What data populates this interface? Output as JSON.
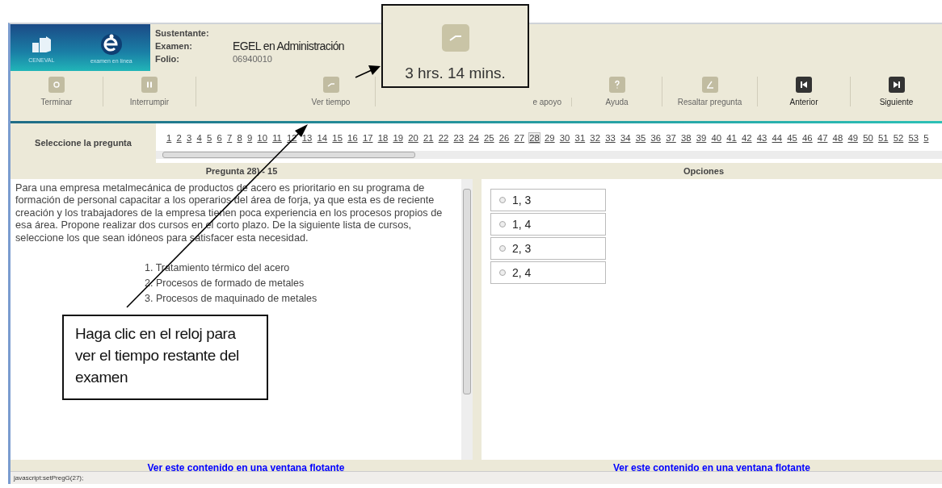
{
  "logo": {
    "left_caption": "CENEVAL",
    "right_caption": "examen en línea"
  },
  "exam_info": [
    {
      "label": "Sustentante:"
    },
    {
      "label": "Examen:",
      "value": "EGEL en Administración"
    },
    {
      "label": "Folio:",
      "value": "06940010"
    }
  ],
  "toolbar": [
    {
      "label": "Terminar",
      "kind": "stop",
      "disabled": true
    },
    {
      "label": "Interrumpir",
      "kind": "pause",
      "disabled": true
    },
    {
      "label": "Ver tiempo",
      "kind": "clock",
      "disabled": true
    },
    {
      "label": "e apoyo",
      "kind": "hidden",
      "disabled": true
    },
    {
      "label": "Ayuda",
      "kind": "help",
      "disabled": true
    },
    {
      "label": "Resaltar pregunta",
      "kind": "highlight",
      "disabled": true
    },
    {
      "label": "Anterior",
      "kind": "prev",
      "disabled": false
    },
    {
      "label": "Siguiente",
      "kind": "next",
      "disabled": false
    }
  ],
  "nav": {
    "label": "Seleccione la pregunta",
    "questions": [
      {
        "number": "1",
        "selected": false
      },
      {
        "number": "2",
        "selected": false
      },
      {
        "number": "3",
        "selected": false
      },
      {
        "number": "4",
        "selected": false
      },
      {
        "number": "5",
        "selected": false
      },
      {
        "number": "6",
        "selected": false
      },
      {
        "number": "7",
        "selected": false
      },
      {
        "number": "8",
        "selected": false
      },
      {
        "number": "9",
        "selected": false
      },
      {
        "number": "10",
        "selected": false
      },
      {
        "number": "11",
        "selected": false
      },
      {
        "number": "12",
        "selected": false
      },
      {
        "number": "13",
        "selected": false
      },
      {
        "number": "14",
        "selected": false
      },
      {
        "number": "15",
        "selected": false
      },
      {
        "number": "16",
        "selected": false
      },
      {
        "number": "17",
        "selected": false
      },
      {
        "number": "18",
        "selected": false
      },
      {
        "number": "19",
        "selected": false
      },
      {
        "number": "20",
        "selected": false
      },
      {
        "number": "21",
        "selected": false
      },
      {
        "number": "22",
        "selected": false
      },
      {
        "number": "23",
        "selected": false
      },
      {
        "number": "24",
        "selected": false
      },
      {
        "number": "25",
        "selected": false
      },
      {
        "number": "26",
        "selected": false
      },
      {
        "number": "27",
        "selected": false
      },
      {
        "number": "28",
        "selected": true
      },
      {
        "number": "29",
        "selected": false
      },
      {
        "number": "30",
        "selected": false
      },
      {
        "number": "31",
        "selected": false
      },
      {
        "number": "32",
        "selected": false
      },
      {
        "number": "33",
        "selected": false
      },
      {
        "number": "34",
        "selected": false
      },
      {
        "number": "35",
        "selected": false
      },
      {
        "number": "36",
        "selected": false
      },
      {
        "number": "37",
        "selected": false
      },
      {
        "number": "38",
        "selected": false
      },
      {
        "number": "39",
        "selected": false
      },
      {
        "number": "40",
        "selected": false
      },
      {
        "number": "41",
        "selected": false
      },
      {
        "number": "42",
        "selected": false
      },
      {
        "number": "43",
        "selected": false
      },
      {
        "number": "44",
        "selected": false
      },
      {
        "number": "45",
        "selected": false
      },
      {
        "number": "46",
        "selected": false
      },
      {
        "number": "47",
        "selected": false
      },
      {
        "number": "48",
        "selected": false
      },
      {
        "number": "49",
        "selected": false
      },
      {
        "number": "50",
        "selected": false
      },
      {
        "number": "51",
        "selected": false
      },
      {
        "number": "52",
        "selected": false
      },
      {
        "number": "53",
        "selected": false
      },
      {
        "number": "5",
        "selected": false
      }
    ]
  },
  "question": {
    "title": "Pregunta 28) - 15",
    "text": "Para una empresa metalmecánica de productos de acero es prioritario en su programa de formación de personal capacitar a los operarios del área de forja, ya que esta es de reciente creación y los trabajadores de la empresa tienen poca experiencia en los procesos propios de esa área. Propone realizar dos cursos en el corto plazo. De la siguiente lista de cursos, seleccione los que sean idóneos para satisfacer esta necesidad.",
    "items": [
      "1. Tratamiento térmico del acero",
      "2. Procesos de formado de metales",
      "3. Procesos de maquinado de metales"
    ]
  },
  "options": {
    "title": "Opciones",
    "choices": [
      {
        "label": "1, 3",
        "selected": false
      },
      {
        "label": "1, 4",
        "selected": false
      },
      {
        "label": "2, 3",
        "selected": false
      },
      {
        "label": "2, 4",
        "selected": false
      }
    ]
  },
  "links": [
    "Ver este contenido en una ventana flotante",
    "Ver este contenido en una ventana flotante"
  ],
  "status_bar": "javascript:setPregG(27);",
  "callouts": {
    "time": "3 hrs. 14 mins.",
    "note": "Haga clic en el reloj para ver el tiempo restante del examen"
  }
}
